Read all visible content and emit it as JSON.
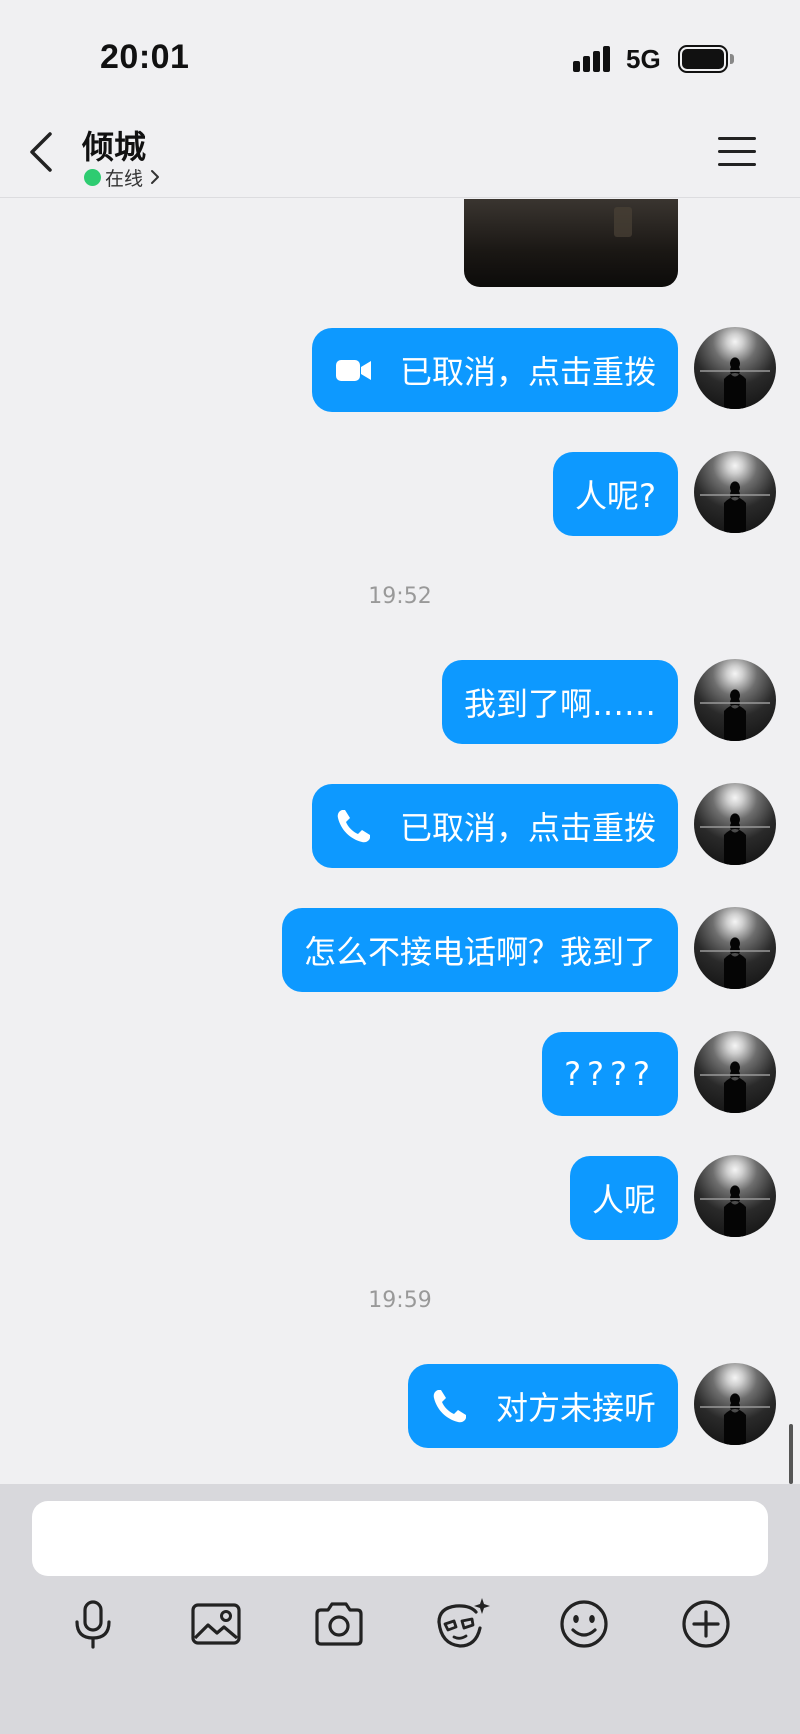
{
  "status_bar": {
    "time": "20:01",
    "network": "5G"
  },
  "header": {
    "contact_name": "倾城",
    "status_text": "在线",
    "status_color": "#2ecc71"
  },
  "messages": [
    {
      "type": "video-call",
      "text": "已取消，点击重拨",
      "icon": "video-camera-icon"
    },
    {
      "type": "text",
      "text": "人呢?"
    },
    {
      "type": "time",
      "text": "19:52"
    },
    {
      "type": "text",
      "text": "我到了啊……"
    },
    {
      "type": "voice-call",
      "text": "已取消，点击重拨",
      "icon": "phone-icon"
    },
    {
      "type": "text",
      "text": "怎么不接电话啊？我到了"
    },
    {
      "type": "text",
      "text": "????"
    },
    {
      "type": "text",
      "text": "人呢"
    },
    {
      "type": "time",
      "text": "19:59"
    },
    {
      "type": "voice-call",
      "text": "对方未接听",
      "icon": "phone-icon"
    }
  ],
  "input": {
    "placeholder": "",
    "value": ""
  },
  "toolbar": [
    "microphone-icon",
    "image-icon",
    "camera-icon",
    "face-sparkle-icon",
    "emoji-icon",
    "plus-circle-icon"
  ],
  "colors": {
    "bubble": "#0d99ff",
    "background": "#f0f0f2",
    "input_area": "#d8d8dc"
  }
}
